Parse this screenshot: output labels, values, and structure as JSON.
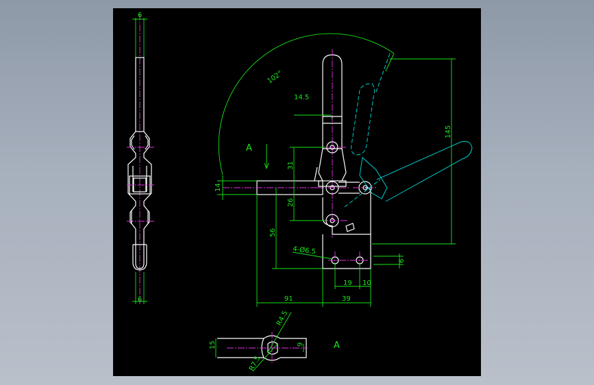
{
  "drawing": {
    "view_label": "A",
    "section_label": "A",
    "dimensions": {
      "side_top_width": "6",
      "side_bottom_width": "6",
      "angle": "102°",
      "handle_width": "14.5",
      "height_overall": "145",
      "upper_offset": "31",
      "lower_offset": "26",
      "bar_thickness": "14",
      "vertical_to_holes": "56",
      "holes_note": "4-Ø6.5",
      "hole_edge": "6",
      "hole_pitch": "19",
      "hole_margin": "10",
      "reach": "91",
      "base_width": "39",
      "slot_height": "15",
      "slot_width": "9",
      "inner_radius": "R4.5",
      "outer_radius": "R7.5"
    }
  },
  "colors": {
    "background": "#8e99a8",
    "frame": "#000000",
    "outline": "#ffffff",
    "dimension": "#19e619",
    "phantom": "#00cccc",
    "centerline": "#e033e0"
  }
}
